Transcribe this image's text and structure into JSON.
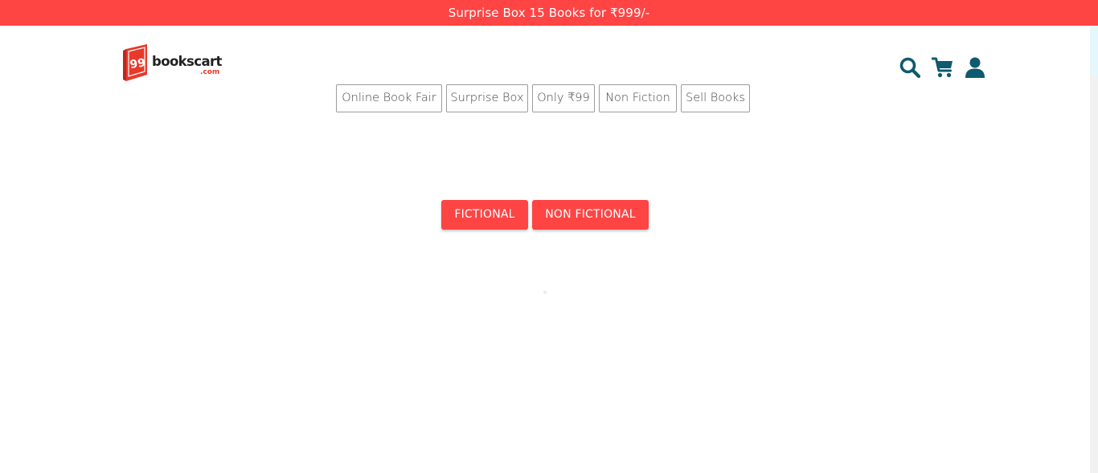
{
  "promo": {
    "text": "Surprise Box 15 Books for ₹999/-"
  },
  "logo": {
    "badge_number": "99",
    "wordmark": "bookscart",
    "domain": ".com"
  },
  "header_icons": [
    "search-icon",
    "cart-icon",
    "user-icon"
  ],
  "nav": {
    "items": [
      {
        "label": "Online Book Fair"
      },
      {
        "label": "Surprise Box"
      },
      {
        "label": "Only ₹99"
      },
      {
        "label": "Non Fiction"
      },
      {
        "label": "Sell Books"
      }
    ]
  },
  "categories": {
    "fictional_label": "FICTIONAL",
    "non_fictional_label": "NON FICTIONAL"
  },
  "colors": {
    "brand_red": "#ff4444",
    "icon_teal": "#0e5a6e",
    "nav_border": "#9c9c9c",
    "logo_red": "#e8392b"
  }
}
